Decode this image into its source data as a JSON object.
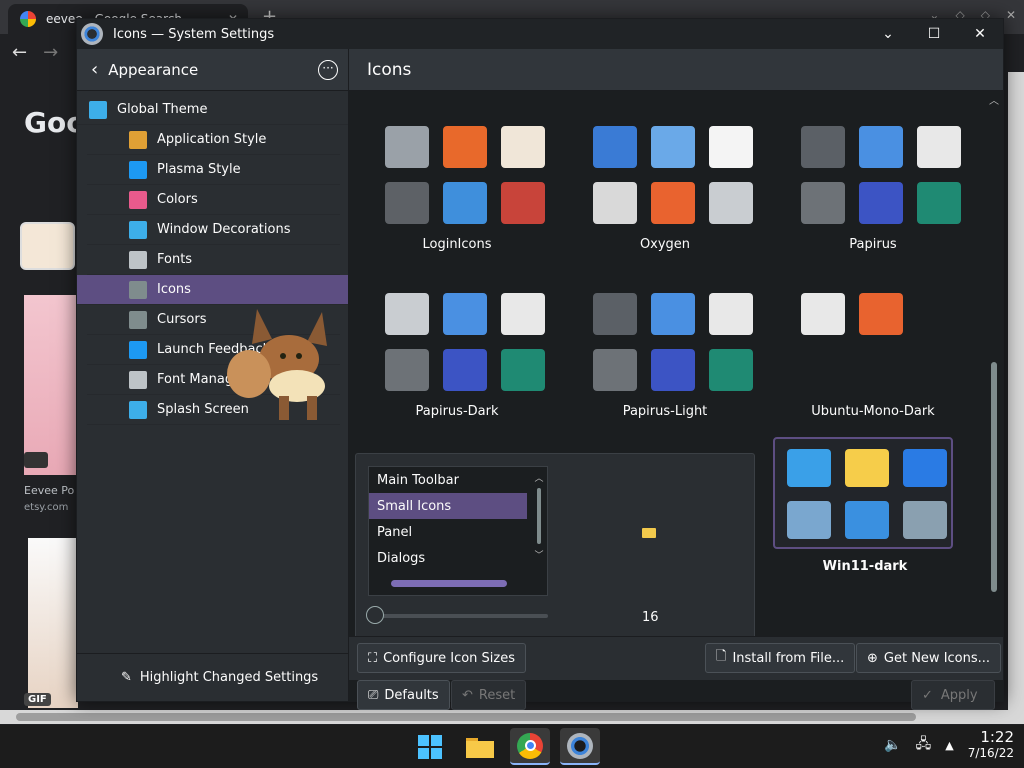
{
  "browser": {
    "tab_title": "eevee - Google Search",
    "logo_text": "Goo",
    "caption1": "Eevee Po",
    "caption2": "etsy.com",
    "gif_badge": "GIF"
  },
  "window": {
    "title": "Icons — System Settings"
  },
  "sidebar": {
    "header": "Appearance",
    "items": [
      {
        "label": "Global Theme",
        "color": "#3daee9"
      },
      {
        "label": "Application Style",
        "color": "#e0a035"
      },
      {
        "label": "Plasma Style",
        "color": "#1d99f3"
      },
      {
        "label": "Colors",
        "color": "#e85a8c"
      },
      {
        "label": "Window Decorations",
        "color": "#3daee9"
      },
      {
        "label": "Fonts",
        "color": "#bdc3c7"
      },
      {
        "label": "Icons",
        "color": "#7f8c8d"
      },
      {
        "label": "Cursors",
        "color": "#7f8c8d"
      },
      {
        "label": "Launch Feedback",
        "color": "#1d99f3"
      },
      {
        "label": "Font Managem",
        "color": "#bdc3c7"
      },
      {
        "label": "Splash Screen",
        "color": "#3daee9"
      }
    ],
    "footer": "Highlight Changed Settings"
  },
  "main": {
    "title": "Icons",
    "themes": [
      {
        "name": "LoginIcons"
      },
      {
        "name": "Oxygen"
      },
      {
        "name": "Papirus"
      },
      {
        "name": "Papirus-Dark"
      },
      {
        "name": "Papirus-Light"
      },
      {
        "name": "Ubuntu-Mono-Dark"
      },
      {
        "name": "Win11-dark"
      }
    ]
  },
  "popup": {
    "list": [
      "Main Toolbar",
      "Small Icons",
      "Panel",
      "Dialogs"
    ],
    "selected": "Small Icons",
    "size_value": "16"
  },
  "buttons": {
    "configure": "Configure Icon Sizes",
    "install": "Install from File...",
    "get_new": "Get New Icons...",
    "defaults": "Defaults",
    "reset": "Reset",
    "apply": "Apply"
  },
  "taskbar": {
    "time": "1:22",
    "date": "7/16/22"
  }
}
